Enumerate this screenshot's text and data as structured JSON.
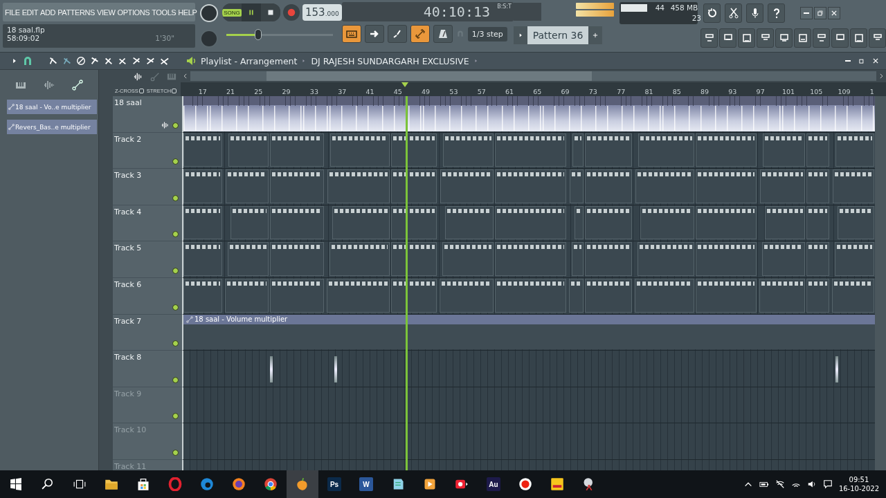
{
  "menu": [
    "FILE",
    "EDIT",
    "ADD",
    "PATTERNS",
    "VIEW",
    "OPTIONS",
    "TOOLS",
    "HELP"
  ],
  "transport": {
    "mode_label": "SONG",
    "song_mode": true,
    "playing": true,
    "tempo": "153",
    "tempo_decimals": ".000",
    "time": "40:10:13",
    "time_unit": "B:S:T"
  },
  "project": {
    "file": "18 saal.flp",
    "time": "58:09:02",
    "length": "1'30\""
  },
  "master_pitch": {
    "level": 0.3
  },
  "performance": {
    "polyphony": "44",
    "memory": "458 MB",
    "cpu": "23"
  },
  "toolbar": {
    "toggles": [
      {
        "kind": "typing",
        "on": true
      },
      {
        "kind": "arrow",
        "on": false
      },
      {
        "kind": "step",
        "on": false
      },
      {
        "kind": "link",
        "on": true
      },
      {
        "kind": "metronome",
        "on": false
      }
    ],
    "snap": "1/3 step",
    "pattern": "Pattern 36"
  },
  "playlist": {
    "title": "Playlist - Arrangement",
    "subtitle": "DJ RAJESH SUNDARGARH EXCLUSIVE",
    "options": [
      {
        "label": "Z-CROSS",
        "checked": false
      },
      {
        "label": "STRETCH",
        "checked": false
      }
    ],
    "ruler": [
      "17",
      "21",
      "25",
      "29",
      "33",
      "37",
      "41",
      "45",
      "49",
      "53",
      "57",
      "61",
      "65",
      "69",
      "73",
      "77",
      "81",
      "85",
      "89",
      "93",
      "97",
      "101",
      "105",
      "109",
      "1"
    ],
    "playhead": {
      "level": 0.324
    },
    "picker": [
      "18 saal - Vo..e multiplier",
      "Revers_Bas..e multiplier"
    ],
    "tracks": [
      {
        "name": "18 saal",
        "kind": "audio"
      },
      {
        "name": "Track 2",
        "kind": "pattern"
      },
      {
        "name": "Track 3",
        "kind": "pattern"
      },
      {
        "name": "Track 4",
        "kind": "pattern"
      },
      {
        "name": "Track 5",
        "kind": "pattern"
      },
      {
        "name": "Track 6",
        "kind": "pattern"
      },
      {
        "name": "Track 7",
        "kind": "automation",
        "clip": "18 saal - Volume multiplier"
      },
      {
        "name": "Track 8",
        "kind": "sparse"
      },
      {
        "name": "Track 9",
        "kind": "empty"
      },
      {
        "name": "Track 10",
        "kind": "empty"
      },
      {
        "name": "Track 11",
        "kind": "empty"
      }
    ]
  },
  "taskbar": {
    "apps": [
      {
        "kind": "start",
        "active": false
      },
      {
        "kind": "search",
        "active": false
      },
      {
        "kind": "taskview",
        "active": false
      },
      {
        "kind": "folder",
        "active": false
      },
      {
        "kind": "store",
        "active": false
      },
      {
        "kind": "opera",
        "active": false
      },
      {
        "kind": "edge",
        "active": false
      },
      {
        "kind": "firefox",
        "active": false
      },
      {
        "kind": "chrome",
        "active": false
      },
      {
        "kind": "fruit",
        "active": true
      },
      {
        "kind": "badge",
        "label": "Ps",
        "color": "#0b2a4a",
        "active": false
      },
      {
        "kind": "badge",
        "label": "W",
        "color": "#2b579a",
        "active": false
      },
      {
        "kind": "notepad",
        "active": false
      },
      {
        "kind": "player",
        "active": false
      },
      {
        "kind": "redapp",
        "active": false
      },
      {
        "kind": "badge",
        "label": "Au",
        "color": "#1d1a4a",
        "active": false
      },
      {
        "kind": "record",
        "active": false
      },
      {
        "kind": "yellowapp",
        "active": false
      },
      {
        "kind": "tool",
        "active": false
      }
    ],
    "clock": {
      "time": "09:51",
      "date": "16-10-2022"
    }
  }
}
